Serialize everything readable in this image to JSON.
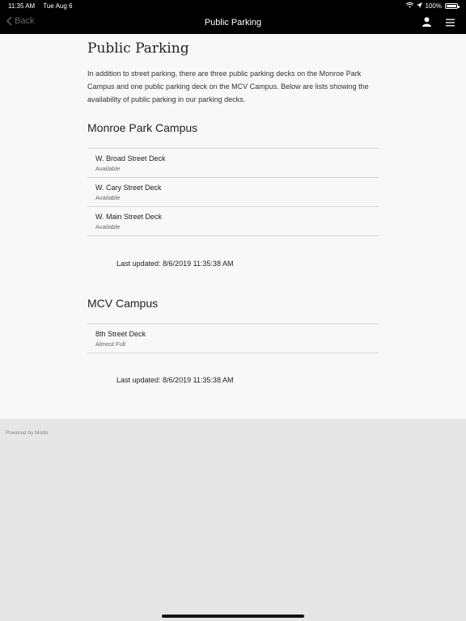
{
  "status_bar": {
    "time": "11:35 AM",
    "date": "Tue Aug 6",
    "battery": "100%"
  },
  "nav": {
    "back_label": "Back",
    "title": "Public Parking"
  },
  "page": {
    "title": "Public Parking",
    "intro": "In addition to street parking, there are three public parking decks on the Monroe Park Campus and one public parking deck on the MCV Campus. Below are lists showing the availability of public parking in our parking decks."
  },
  "sections": [
    {
      "title": "Monroe Park Campus",
      "items": [
        {
          "name": "W. Broad Street Deck",
          "status": "Available"
        },
        {
          "name": "W. Cary Street Deck",
          "status": "Available"
        },
        {
          "name": "W. Main Street Deck",
          "status": "Available"
        }
      ],
      "updated": "Last updated: 8/6/2019 11:35:38 AM"
    },
    {
      "title": "MCV Campus",
      "items": [
        {
          "name": "8th Street Deck",
          "status": "Almost Full"
        }
      ],
      "updated": "Last updated: 8/6/2019 11:35:38 AM"
    }
  ],
  "footer": {
    "powered_by": "Powered by Modo"
  },
  "icons": {
    "back": "chevron-left-icon",
    "user": "user-icon",
    "menu": "menu-icon",
    "wifi": "wifi-icon",
    "location": "location-arrow-icon",
    "battery": "battery-icon"
  }
}
